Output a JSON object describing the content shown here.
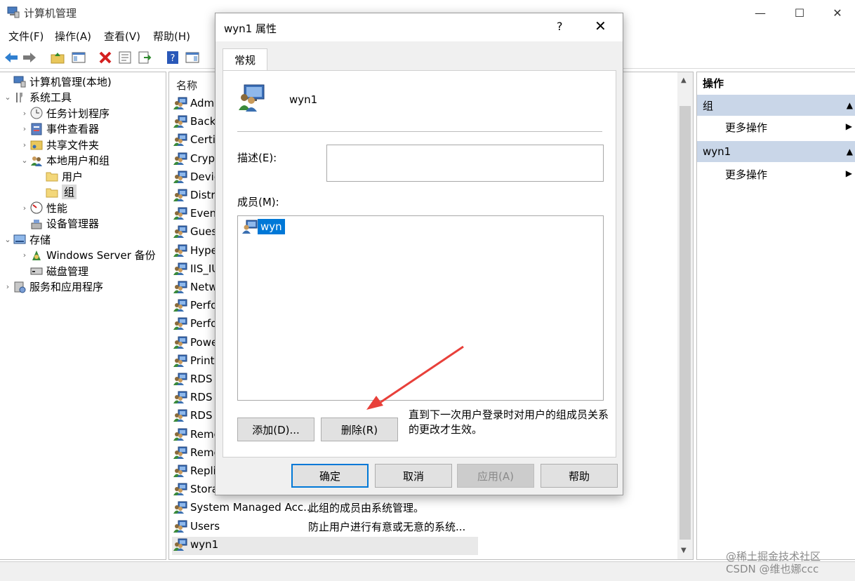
{
  "window": {
    "title": "计算机管理"
  },
  "menu": [
    "文件(F)",
    "操作(A)",
    "查看(V)",
    "帮助(H)"
  ],
  "tree": {
    "items": [
      {
        "label": "计算机管理(本地)",
        "caret": "",
        "icon": "computer-management-icon"
      },
      {
        "label": "系统工具",
        "caret": "⌄",
        "icon": "tools-icon"
      },
      {
        "label": "任务计划程序",
        "caret": "›",
        "icon": "clock-icon"
      },
      {
        "label": "事件查看器",
        "caret": "›",
        "icon": "event-viewer-icon"
      },
      {
        "label": "共享文件夹",
        "caret": "›",
        "icon": "shared-folder-icon"
      },
      {
        "label": "本地用户和组",
        "caret": "⌄",
        "icon": "users-icon"
      },
      {
        "label": "用户",
        "caret": "",
        "icon": "folder-icon"
      },
      {
        "label": "组",
        "caret": "",
        "icon": "folder-icon"
      },
      {
        "label": "性能",
        "caret": "›",
        "icon": "performance-icon"
      },
      {
        "label": "设备管理器",
        "caret": "",
        "icon": "device-manager-icon"
      },
      {
        "label": "存储",
        "caret": "⌄",
        "icon": "storage-icon"
      },
      {
        "label": "Windows Server 备份",
        "caret": "›",
        "icon": "backup-icon"
      },
      {
        "label": "磁盘管理",
        "caret": "",
        "icon": "disk-icon"
      },
      {
        "label": "服务和应用程序",
        "caret": "›",
        "icon": "services-icon"
      }
    ]
  },
  "list": {
    "column_name": "名称",
    "rows": [
      {
        "name": "Admi",
        "desc": ""
      },
      {
        "name": "Backu",
        "desc": ""
      },
      {
        "name": "Certif",
        "desc": ""
      },
      {
        "name": "Crypt",
        "desc": ""
      },
      {
        "name": "Devic",
        "desc": ""
      },
      {
        "name": "Distri",
        "desc": ""
      },
      {
        "name": "Event",
        "desc": ""
      },
      {
        "name": "Guest",
        "desc": ""
      },
      {
        "name": "Hype",
        "desc": ""
      },
      {
        "name": "IIS_IU",
        "desc": ""
      },
      {
        "name": "Netw",
        "desc": ""
      },
      {
        "name": "Perfo",
        "desc": ""
      },
      {
        "name": "Perfo",
        "desc": ""
      },
      {
        "name": "Powe",
        "desc": ""
      },
      {
        "name": "Print (",
        "desc": ""
      },
      {
        "name": "RDS I",
        "desc": ""
      },
      {
        "name": "RDS I",
        "desc": ""
      },
      {
        "name": "RDS I",
        "desc": ""
      },
      {
        "name": "Remo",
        "desc": ""
      },
      {
        "name": "Remo",
        "desc": ""
      },
      {
        "name": "Replic",
        "desc": ""
      },
      {
        "name": "Storag",
        "desc": ""
      },
      {
        "name": "System Managed Acc...",
        "desc": "此组的成员由系统管理。"
      },
      {
        "name": "Users",
        "desc": "防止用户进行有意或无意的系统..."
      },
      {
        "name": "wyn1",
        "desc": ""
      }
    ]
  },
  "actions": {
    "header": "操作",
    "sections": [
      {
        "title": "组",
        "item": "更多操作"
      },
      {
        "title": "wyn1",
        "item": "更多操作"
      }
    ]
  },
  "dialog": {
    "title": "wyn1 属性",
    "help": "?",
    "close": "✕",
    "tab": "常规",
    "group_name": "wyn1",
    "description_label": "描述(E):",
    "description_value": "",
    "members_label": "成员(M):",
    "members": [
      "wyn"
    ],
    "add_button": "添加(D)...",
    "remove_button": "删除(R)",
    "note": "直到下一次用户登录时对用户的组成员关系的更改才生效。",
    "ok_button": "确定",
    "cancel_button": "取消",
    "apply_button": "应用(A)",
    "help_button": "帮助"
  },
  "watermark": {
    "line1": "@稀土掘金技术社区",
    "line2": "CSDN @维也娜ccc"
  },
  "colors": {
    "selection": "#0078d7",
    "annotation_arrow": "#e8403a",
    "action_header": "#c9d6e8"
  }
}
